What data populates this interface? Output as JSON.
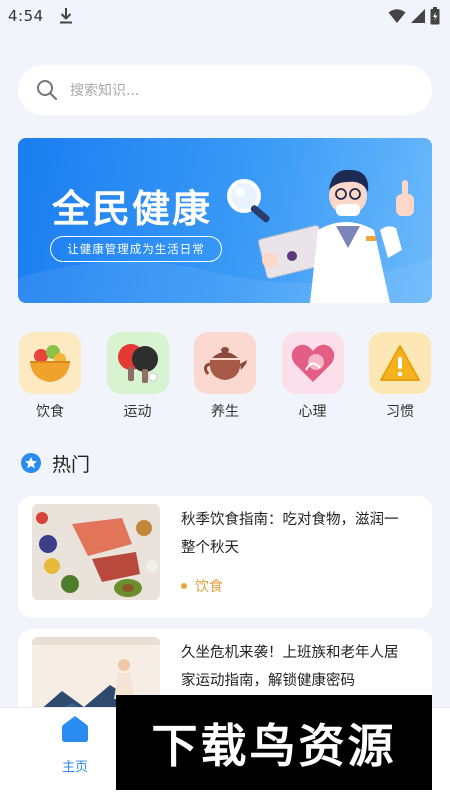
{
  "status_bar": {
    "time": "4:54",
    "icons": [
      "download-icon",
      "wifi-icon",
      "signal-icon",
      "battery-icon"
    ]
  },
  "search": {
    "placeholder": "搜索知识..."
  },
  "banner": {
    "title": "全民健康",
    "subtitle": "让健康管理成为生活日常"
  },
  "categories": [
    {
      "label": "饮食",
      "icon": "food-bowl-icon",
      "tile_color": "#fde9c2"
    },
    {
      "label": "运动",
      "icon": "ping-pong-icon",
      "tile_color": "#d8f3d0"
    },
    {
      "label": "养生",
      "icon": "teapot-icon",
      "tile_color": "#fbd9d0"
    },
    {
      "label": "心理",
      "icon": "heart-icon",
      "tile_color": "#fbe0ec"
    },
    {
      "label": "习惯",
      "icon": "warning-icon",
      "tile_color": "#fde8b5"
    }
  ],
  "hot": {
    "title": "热门"
  },
  "articles": [
    {
      "title": "秋季饮食指南：吃对食物，滋润一整个秋天",
      "tag": "饮食"
    },
    {
      "title": "久坐危机来袭！上班族和老年人居家运动指南，解锁健康密码",
      "tag": ""
    }
  ],
  "bottom_nav": {
    "home_label": "主页"
  },
  "watermark": {
    "text": "下载鸟资源"
  },
  "colors": {
    "accent": "#2a8cf0",
    "banner": "#1a7df0",
    "background": "#f1f4fa",
    "tag": "#e0a040"
  }
}
